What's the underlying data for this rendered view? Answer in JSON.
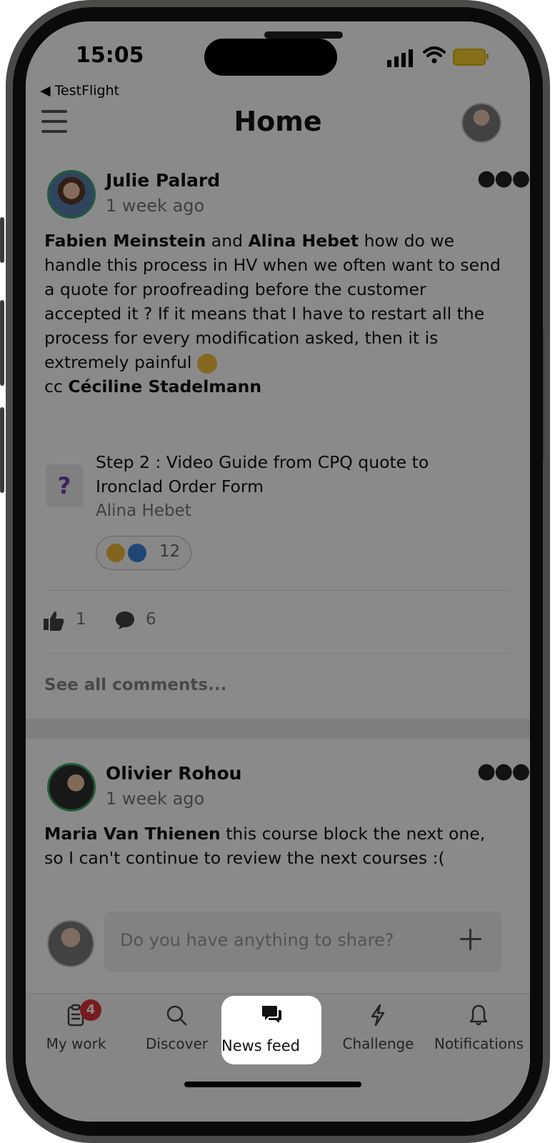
{
  "status": {
    "time": "15:05",
    "back_app": "◀ TestFlight"
  },
  "header": {
    "title": "Home"
  },
  "posts": [
    {
      "author": "Julie Palard",
      "time_ago": "1 week ago",
      "mention1": "Fabien Meinstein",
      "connector": " and ",
      "mention2": "Alina Hebet",
      "text_after": " how do we handle this process in HV when we often want to send a quote for proofreading before the customer accepted it ? If it means that I have to restart all the process for every modification asked, then it is extremely painful ",
      "cc_prefix": "cc ",
      "cc_mention": "Céciline Stadelmann",
      "shared": {
        "title": "Step 2 : Video Guide from CPQ quote to Ironclad Order Form",
        "author": "Alina Hebet",
        "reaction_count": "12",
        "icon": "?"
      },
      "likes": "1",
      "comments": "6",
      "see_all": "See all comments..."
    },
    {
      "author": "Olivier Rohou",
      "time_ago": "1 week ago",
      "mention": "Maria Van Thienen",
      "text_after": " this course block the next one, so I can't continue to review the next courses :("
    }
  ],
  "composer": {
    "placeholder": "Do you have anything to share?"
  },
  "tabs": [
    {
      "label": "My work",
      "icon": "clipboard-icon",
      "badge": "4"
    },
    {
      "label": "Discover",
      "icon": "search-icon"
    },
    {
      "label": "News feed",
      "icon": "chat-bubbles-icon",
      "active": true
    },
    {
      "label": "Challenge",
      "icon": "lightning-icon"
    },
    {
      "label": "Notifications",
      "icon": "bell-icon"
    }
  ],
  "colors": {
    "accent_green": "#3fa66b",
    "badge_red": "#e0303a",
    "question_purple": "#6c3fb8",
    "overlay": "rgba(0,0,0,0.46)"
  }
}
